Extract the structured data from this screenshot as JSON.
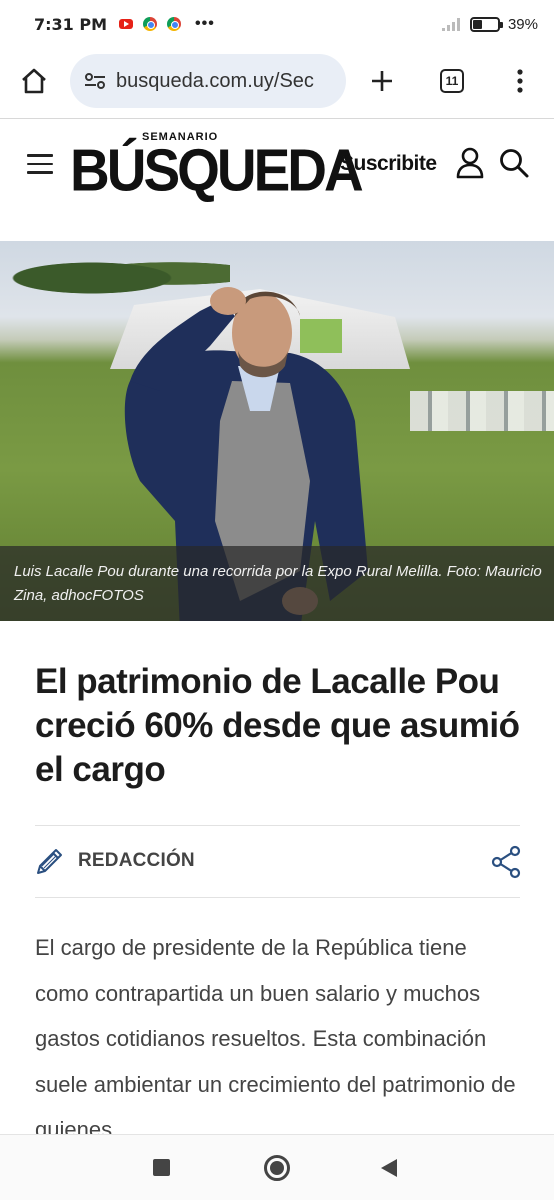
{
  "status_bar": {
    "time": "7:31 PM",
    "notification_icons": [
      "youtube-icon",
      "chrome-icon",
      "chrome-icon"
    ],
    "more_indicator": "•••",
    "battery_percent": "39%",
    "battery_level": 0.39
  },
  "browser": {
    "url": "busqueda.com.uy/Sec",
    "tab_count": "11",
    "icons": [
      "home-icon",
      "site-settings-icon",
      "new-tab-icon",
      "tab-switcher-icon",
      "overflow-menu-icon"
    ]
  },
  "site": {
    "logo_top": "SEMANARIO",
    "logo_main": "BÚSQUEDA",
    "subscribe_label": "Suscribite",
    "icons": [
      "menu-icon",
      "user-icon",
      "search-icon"
    ]
  },
  "hero": {
    "caption": "Luis Lacalle Pou durante una recorrida por la Expo Rural Melilla. Foto: Mauricio Zina, adhocFOTOS"
  },
  "article": {
    "headline": "El patrimonio de Lacalle Pou creció 60% desde que asumió el cargo",
    "author": "REDACCIÓN",
    "body": "El cargo de presidente de la República tiene como contrapartida un buen salario y muchos gastos cotidianos resueltos. Esta combinación suele ambientar un crecimiento del patrimonio de quienes"
  },
  "nav": {
    "icons": [
      "recents-icon",
      "home-circle-icon",
      "back-icon"
    ]
  }
}
